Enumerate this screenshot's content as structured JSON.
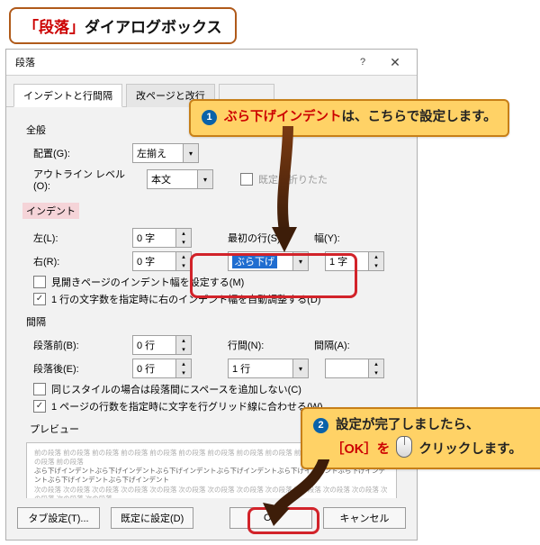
{
  "title_callout": {
    "quote_open": "「",
    "name": "段落",
    "quote_close": "」",
    "suffix": "ダイアログボックス"
  },
  "dialog": {
    "title": "段落",
    "tabs": [
      "インデントと行間隔",
      "改ページと改行"
    ],
    "active_tab": 0,
    "general": {
      "label": "全般",
      "align_label": "配置(G):",
      "align_hotkey": "G",
      "align_value": "左揃え",
      "outline_label": "アウトライン レベル(O):",
      "outline_hotkey": "O",
      "outline_value": "本文",
      "collapsed_label": "既定で折りたた",
      "collapsed_checked": false
    },
    "indent": {
      "label": "インデント",
      "left_label": "左(L):",
      "left_hotkey": "L",
      "left_value": "0 字",
      "right_label": "右(R):",
      "right_hotkey": "R",
      "right_value": "0 字",
      "first_label": "最初の行(S):",
      "first_hotkey": "S",
      "first_value": "ぶら下げ",
      "width_label": "幅(Y):",
      "width_hotkey": "Y",
      "width_value": "1 字",
      "mirror_label": "見開きページのインデント幅を設定する(M)",
      "mirror_checked": false,
      "autoadj_label": "1 行の文字数を指定時に右のインデント幅を自動調整する(D)",
      "autoadj_checked": true
    },
    "spacing": {
      "label": "間隔",
      "before_label": "段落前(B):",
      "before_hotkey": "B",
      "before_value": "0 行",
      "after_label": "段落後(E):",
      "after_hotkey": "E",
      "after_value": "0 行",
      "line_label": "行間(N):",
      "line_hotkey": "N",
      "line_value": "1 行",
      "gap_label": "間隔(A):",
      "gap_hotkey": "A",
      "gap_value": "",
      "samestyle_label": "同じスタイルの場合は段落間にスペースを追加しない(C)",
      "samestyle_checked": false,
      "grid_label": "1 ページの行数を指定時に文字を行グリッド線に合わせる(W)",
      "grid_checked": true
    },
    "preview": {
      "label": "プレビュー",
      "prev_line": "前の段落 前の段落 前の段落 前の段落 前の段落 前の段落 前の段落 前の段落 前の段落 前の段落 前の段落 前の段落 前の段落 前の段落",
      "body_line": "ぶら下げインデントぶら下げインデントぶら下げインデントぶら下げインデントぶら下げインデントぶら下げインデントぶら下げインデントぶら下げインデント",
      "next_line": "次の段落 次の段落 次の段落 次の段落 次の段落 次の段落 次の段落 次の段落 次の段落 次の段落 次の段落 次の段落 次の段落 次の段落 次の段落"
    },
    "buttons": {
      "tabset": "タブ設定(T)...",
      "default": "既定に設定(D)",
      "ok": "OK",
      "cancel": "キャンセル"
    }
  },
  "balloons": {
    "b1_num": "1",
    "b1_kw": "ぶら下げインデント",
    "b1_rest": "は、こちらで設定します。",
    "b2_num": "2",
    "b2_line1": "設定が完了しましたら、",
    "b2_ok_open": "［",
    "b2_ok": "OK",
    "b2_ok_close": "］を",
    "b2_click": "クリック",
    "b2_end": "します。"
  }
}
